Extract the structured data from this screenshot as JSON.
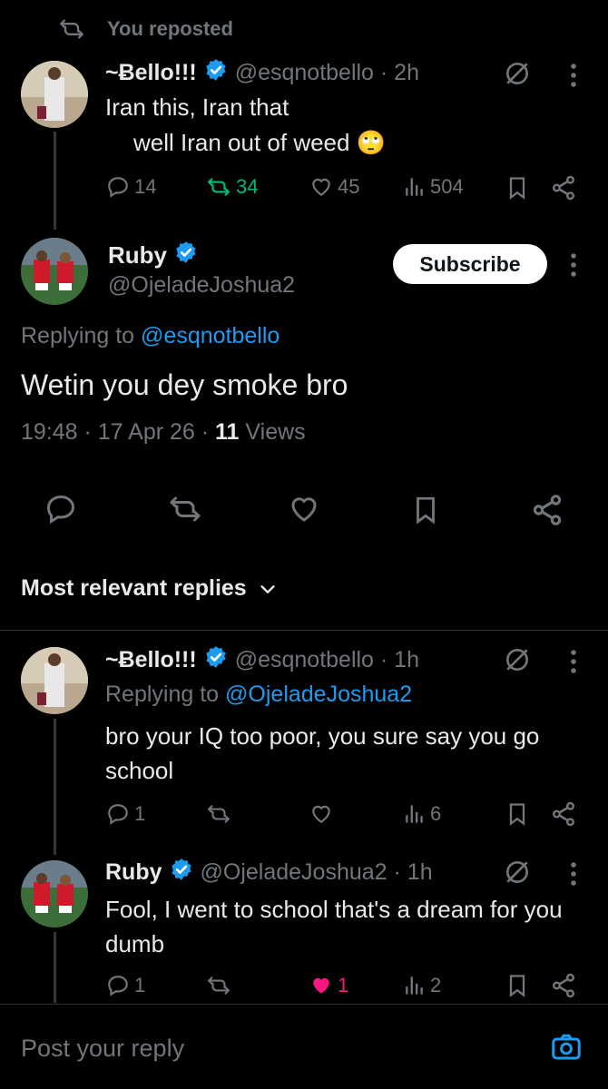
{
  "repost_banner": {
    "text": "You reposted"
  },
  "tweet1": {
    "name": "~Ƀello!!!",
    "meta": "@esqnotbello · 2h",
    "line1": "Iran this, Iran that",
    "line2": "well Iran out of weed 🙄",
    "replies": "14",
    "reposts": "34",
    "likes": "45",
    "views": "504"
  },
  "main": {
    "name": "Ruby",
    "handle": "@OjeladeJoshua2",
    "subscribe_label": "Subscribe",
    "replying_prefix": "Replying to",
    "replying_handle": "@esqnotbello",
    "text": "Wetin you dey smoke bro",
    "timestamp": "19:48 · 17 Apr 26 · ",
    "views_count": "11",
    "views_label": " Views"
  },
  "sort": {
    "label": "Most relevant replies"
  },
  "reply1": {
    "name": "~Ƀello!!!",
    "meta": "@esqnotbello · 1h",
    "replying_prefix": "Replying to ",
    "replying_handle": "@OjeladeJoshua2",
    "text": "bro your IQ too poor, you sure say you go school",
    "replies": "1",
    "views": "6"
  },
  "reply2": {
    "name": "Ruby",
    "meta": "@OjeladeJoshua2 · 1h",
    "text": "Fool, I went to school that's a dream for you dumb",
    "replies": "1",
    "likes": "1",
    "views": "2"
  },
  "composer": {
    "placeholder": "Post your reply"
  },
  "colors": {
    "accent": "#1d9bf0",
    "repost": "#00ba7c",
    "like": "#f91880",
    "muted": "#71767b"
  }
}
